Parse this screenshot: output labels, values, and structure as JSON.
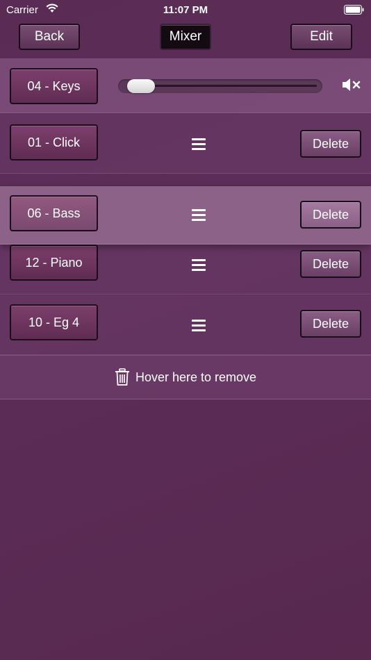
{
  "status_bar": {
    "carrier": "Carrier",
    "time": "11:07 PM",
    "icons": [
      "wifi-icon",
      "battery-icon"
    ]
  },
  "nav": {
    "back_label": "Back",
    "title": "Mixer",
    "edit_label": "Edit"
  },
  "master": {
    "name": "04 - Keys",
    "volume_fraction": 0.05,
    "muted": true
  },
  "tracks": [
    {
      "name": "01 - Click",
      "delete_label": "Delete"
    },
    {
      "name": "06 - Bass",
      "delete_label": "Delete",
      "dragging": true
    },
    {
      "name": "12 - Piano",
      "delete_label": "Delete"
    },
    {
      "name": "10 - Eg 4",
      "delete_label": "Delete"
    }
  ],
  "remove_zone": {
    "label": "Hover here to remove",
    "icon": "trash-icon"
  },
  "colors": {
    "background": "#5a2c55",
    "row_highlight": "#8c6289",
    "button_border": "#1a0c18"
  }
}
